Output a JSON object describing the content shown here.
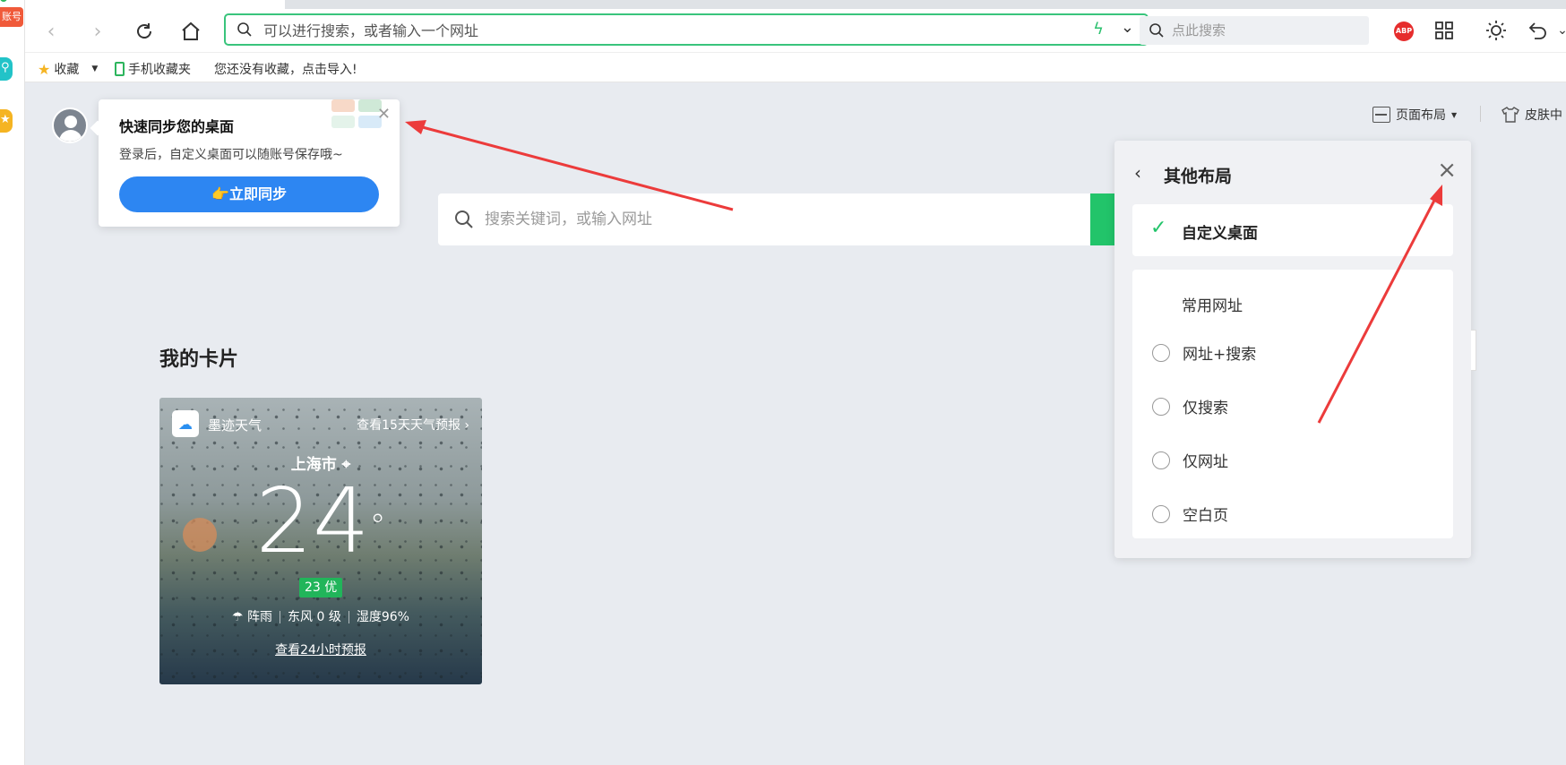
{
  "rail": {
    "account_label": "账号"
  },
  "toolbar": {
    "url_placeholder": "可以进行搜索，或者输入一个网址",
    "side_search_placeholder": "点此搜索",
    "abp_label": "ABP"
  },
  "bookmarks": {
    "favorites": "收藏",
    "mobile": "手机收藏夹",
    "hint": "您还没有收藏，点击导入!"
  },
  "sync_popup": {
    "title": "快速同步您的桌面",
    "desc": "登录后，自定义桌面可以随账号保存哦~",
    "button": "👉立即同步"
  },
  "main_search": {
    "placeholder": "搜索关键词，或输入网址"
  },
  "cards": {
    "title": "我的卡片",
    "weather": {
      "brand": "墨迹天气",
      "forecast15": "查看15天天气预报 ›",
      "city": "上海市",
      "temperature": "24",
      "degree": "°",
      "aqi": "23 优",
      "condition": "阵雨",
      "wind": "东风 0 级",
      "humidity": "湿度96%",
      "forecast24": "查看24小时预报"
    }
  },
  "header": {
    "layout": "页面布局",
    "skin": "皮肤中"
  },
  "layout_panel": {
    "title": "其他布局",
    "selected": "自定义桌面",
    "group_label": "常用网址",
    "options": [
      "网址+搜索",
      "仅搜索",
      "仅网址",
      "空白页"
    ]
  },
  "colors": {
    "accent_green": "#22c46a",
    "sync_blue": "#2d86f2",
    "arrow_red": "#ec3b3b"
  }
}
